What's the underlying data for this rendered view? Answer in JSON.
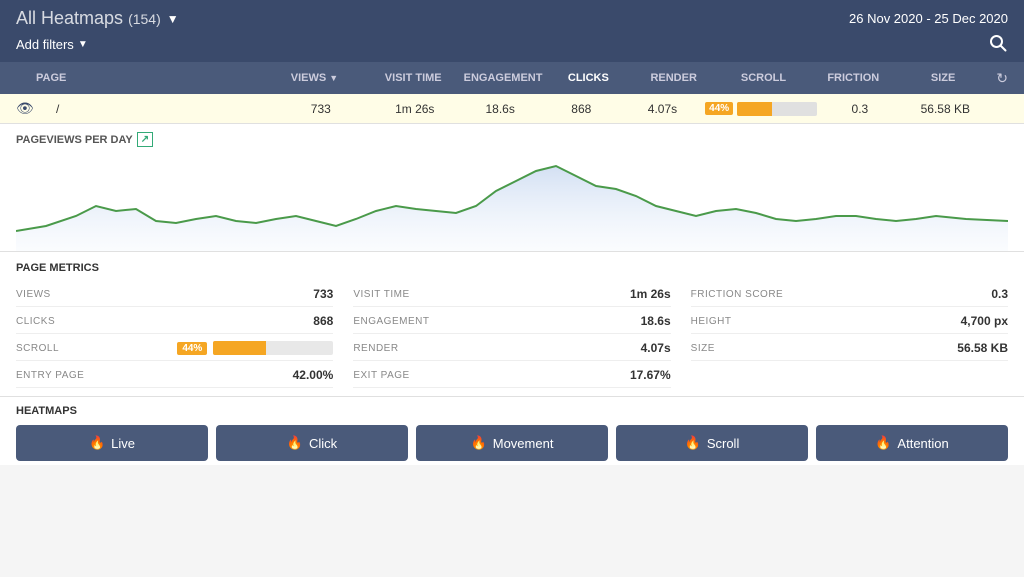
{
  "header": {
    "title": "All Heatmaps",
    "count": "(154)",
    "date_range": "26 Nov 2020 - 25 Dec 2020",
    "add_filters_label": "Add filters"
  },
  "table": {
    "columns": {
      "page": "PAGE",
      "views": "VIEWS",
      "visit_time": "VISIT TIME",
      "engagement": "ENGAGEMENT",
      "clicks": "CLICKS",
      "render": "RENDER",
      "scroll": "SCROLL",
      "friction": "FRICTION",
      "size": "SIZE"
    },
    "row": {
      "page": "/",
      "views": "733",
      "visit_time": "1m 26s",
      "engagement": "18.6s",
      "clicks": "868",
      "render": "4.07s",
      "scroll_pct": "44%",
      "scroll_fill_pct": 44,
      "friction": "0.3",
      "size": "56.58 KB"
    }
  },
  "chart": {
    "title": "PAGEVIEWS PER DAY",
    "export_label": "↗"
  },
  "metrics": {
    "title": "PAGE METRICS",
    "left": [
      {
        "label": "VIEWS",
        "value": "733"
      },
      {
        "label": "CLICKS",
        "value": "868"
      },
      {
        "label": "SCROLL",
        "value": "44%",
        "type": "bar",
        "fill": 44
      },
      {
        "label": "ENTRY PAGE",
        "value": "42.00%"
      }
    ],
    "center": [
      {
        "label": "VISIT TIME",
        "value": "1m 26s"
      },
      {
        "label": "ENGAGEMENT",
        "value": "18.6s"
      },
      {
        "label": "RENDER",
        "value": "4.07s"
      },
      {
        "label": "EXIT PAGE",
        "value": "17.67%"
      }
    ],
    "right": [
      {
        "label": "FRICTION SCORE",
        "value": "0.3"
      },
      {
        "label": "HEIGHT",
        "value": "4,700 px"
      },
      {
        "label": "SIZE",
        "value": "56.58 KB"
      }
    ]
  },
  "heatmaps": {
    "title": "HEATMAPS",
    "buttons": [
      {
        "label": "Live",
        "icon": "🔥"
      },
      {
        "label": "Click",
        "icon": "🔥"
      },
      {
        "label": "Movement",
        "icon": "🔥"
      },
      {
        "label": "Scroll",
        "icon": "🔥"
      },
      {
        "label": "Attention",
        "icon": "🔥"
      }
    ]
  }
}
